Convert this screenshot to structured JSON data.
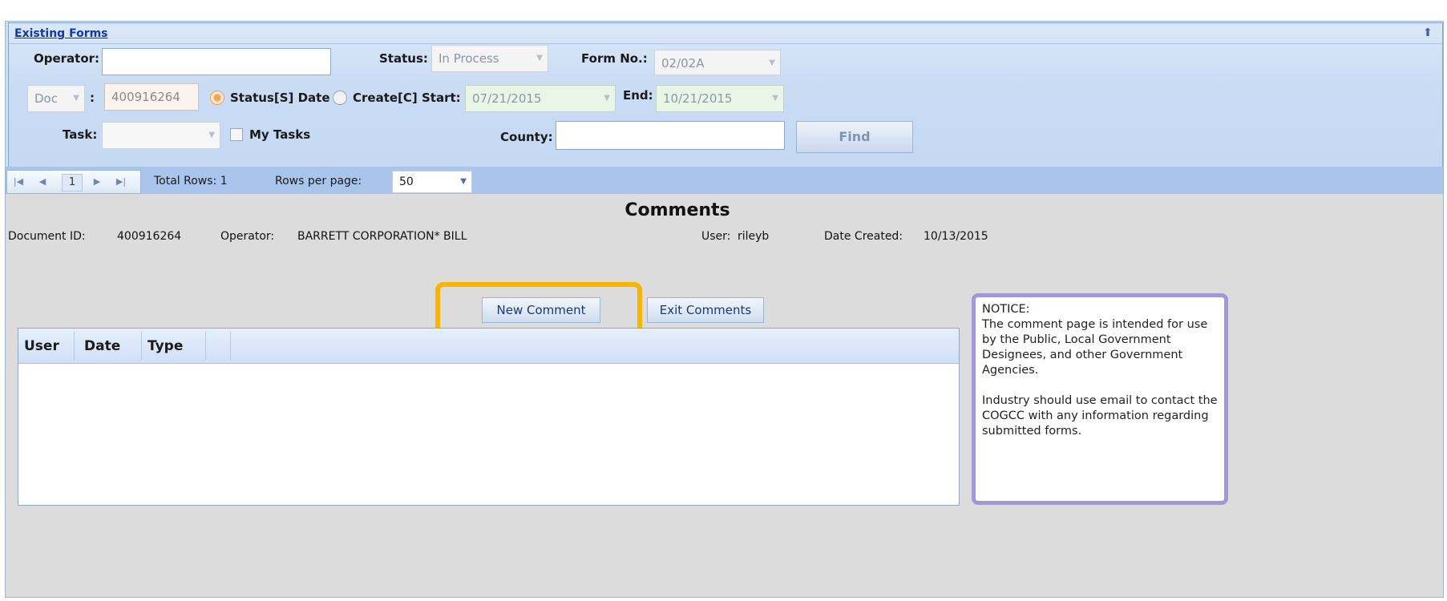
{
  "panel": {
    "title": "Existing Forms"
  },
  "search": {
    "operator_label": "Operator:",
    "operator_value": "",
    "status_label": "Status:",
    "status_value": "In Process",
    "form_no_label": "Form No.:",
    "form_no_value": "02/02A",
    "doc_type_value": "Doc",
    "doc_sep": ":",
    "doc_number_value": "400916264",
    "radio_status_label": "Status[S] Date",
    "radio_create_label": "Create[C]",
    "start_label": "Start:",
    "start_value": "07/21/2015",
    "end_label": "End:",
    "end_value": "10/21/2015",
    "task_label": "Task:",
    "task_value": "",
    "my_tasks_label": "My Tasks",
    "county_label": "County:",
    "county_value": "",
    "find_label": "Find"
  },
  "pager": {
    "current_page": "1",
    "total_rows_text": "Total Rows: 1",
    "rows_per_page_label": "Rows per page:",
    "rows_per_page_value": "50"
  },
  "comments": {
    "title": "Comments",
    "document_id_label": "Document ID:",
    "document_id_value": "400916264",
    "operator_label": "Operator:",
    "operator_value": "BARRETT CORPORATION* BILL",
    "user_label": "User:",
    "user_value": "rileyb",
    "date_created_label": "Date Created:",
    "date_created_value": "10/13/2015",
    "new_comment_label": "New Comment",
    "exit_comments_label": "Exit Comments",
    "columns": [
      "User",
      "Date",
      "Type"
    ]
  },
  "notice": {
    "heading": "NOTICE:",
    "line1": "The comment page is intended for use by the Public, Local Government Designees, and other Government Agencies.",
    "line2": "Industry should use email to contact the COGCC with any information regarding submitted forms."
  }
}
